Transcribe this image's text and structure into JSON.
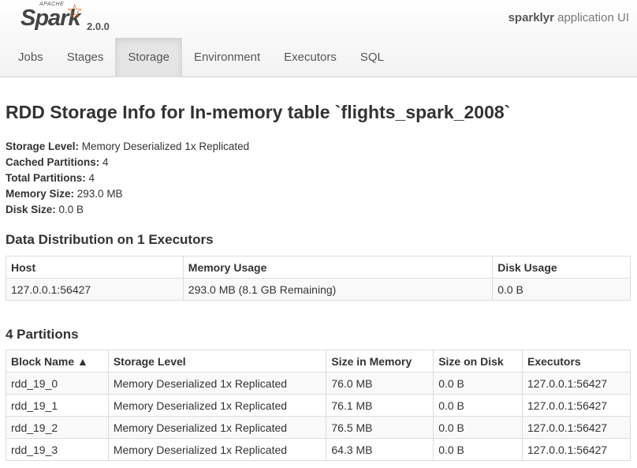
{
  "brand": {
    "apache": "APACHE",
    "name": "Spark",
    "version": "2.0.0",
    "accent_color": "#e25a1c"
  },
  "app": {
    "name_bold": "sparklyr",
    "name_rest": " application UI"
  },
  "nav": {
    "tabs": [
      {
        "label": "Jobs"
      },
      {
        "label": "Stages"
      },
      {
        "label": "Storage",
        "active": true
      },
      {
        "label": "Environment"
      },
      {
        "label": "Executors"
      },
      {
        "label": "SQL"
      }
    ]
  },
  "page": {
    "title": "RDD Storage Info for In-memory table `flights_spark_2008`",
    "info": [
      {
        "key": "Storage Level:",
        "value": " Memory Deserialized 1x Replicated"
      },
      {
        "key": "Cached Partitions:",
        "value": " 4"
      },
      {
        "key": "Total Partitions:",
        "value": " 4"
      },
      {
        "key": "Memory Size:",
        "value": " 293.0 MB"
      },
      {
        "key": "Disk Size:",
        "value": " 0.0 B"
      }
    ]
  },
  "distribution": {
    "title": "Data Distribution on 1 Executors",
    "headers": [
      "Host",
      "Memory Usage",
      "Disk Usage"
    ],
    "rows": [
      [
        "127.0.0.1:56427",
        "293.0 MB (8.1 GB Remaining)",
        "0.0 B"
      ]
    ]
  },
  "partitions": {
    "title": "4 Partitions",
    "headers": [
      "Block Name ▲",
      "Storage Level",
      "Size in Memory",
      "Size on Disk",
      "Executors"
    ],
    "rows": [
      [
        "rdd_19_0",
        "Memory Deserialized 1x Replicated",
        "76.0 MB",
        "0.0 B",
        "127.0.0.1:56427"
      ],
      [
        "rdd_19_1",
        "Memory Deserialized 1x Replicated",
        "76.1 MB",
        "0.0 B",
        "127.0.0.1:56427"
      ],
      [
        "rdd_19_2",
        "Memory Deserialized 1x Replicated",
        "76.5 MB",
        "0.0 B",
        "127.0.0.1:56427"
      ],
      [
        "rdd_19_3",
        "Memory Deserialized 1x Replicated",
        "64.3 MB",
        "0.0 B",
        "127.0.0.1:56427"
      ]
    ]
  }
}
